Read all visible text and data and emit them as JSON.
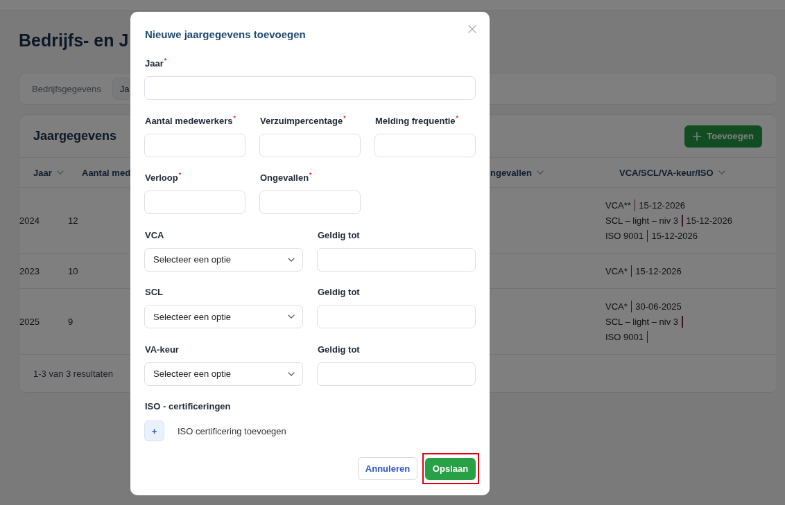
{
  "page": {
    "title": "Bedrijfs- en J",
    "tabs": [
      {
        "label": "Bedrijfsgegevens",
        "selected": false
      },
      {
        "label": "Ja",
        "selected": true
      }
    ]
  },
  "table": {
    "title": "Jaargegevens",
    "add_button": "Toevoegen",
    "columns": [
      {
        "label": "Jaar",
        "sortable": true
      },
      {
        "label": "Aantal med"
      },
      {
        "label": "ngevallen",
        "sortable": true
      },
      {
        "label": "VCA/SCL/VA-keur/ISO",
        "sortable": true
      }
    ],
    "rows": [
      {
        "cells": [
          "2024",
          "12"
        ],
        "certificates": [
          {
            "name": "VCA**",
            "valid_until": "15-12-2026"
          },
          {
            "name": "SCL – light – niv 3",
            "valid_until": "15-12-2026"
          },
          {
            "name": "ISO 9001",
            "valid_until": "15-12-2026"
          }
        ]
      },
      {
        "cells": [
          "2023",
          "10"
        ],
        "certificates": [
          {
            "name": "VCA*",
            "valid_until": "15-12-2026"
          }
        ]
      },
      {
        "cells": [
          "2025",
          "9"
        ],
        "certificates": [
          {
            "name": "VCA*",
            "valid_until": "30-06-2025"
          },
          {
            "name": "SCL – light – niv 3"
          },
          {
            "name": "ISO 9001"
          }
        ]
      }
    ],
    "footer": "1-3 van 3 resultaten"
  },
  "modal": {
    "title": "Nieuwe jaargegevens toevoegen",
    "year_field": {
      "label": "Jaar",
      "required_mark": "*"
    },
    "metric_fields": [
      {
        "label": "Aantal medewerkers",
        "required_mark": "*"
      },
      {
        "label": "Verzuimpercentage",
        "required_mark": "*"
      },
      {
        "label": "Melding frequentie",
        "required_mark": "*"
      },
      {
        "label": "Verloop",
        "required_mark": "*"
      },
      {
        "label": "Ongevallen",
        "required_mark": "*"
      }
    ],
    "certificate_fields": [
      {
        "label": "VCA",
        "placeholder": "Selecteer een optie",
        "date_label": "Geldig tot"
      },
      {
        "label": "SCL",
        "placeholder": "Selecteer een optie",
        "date_label": "Geldig tot"
      },
      {
        "label": "VA-keur",
        "placeholder": "Selecteer een optie",
        "date_label": "Geldig tot"
      }
    ],
    "iso": {
      "label": "ISO - certificeringen",
      "add_button": "+",
      "add_label": "ISO certificering toevoegen"
    },
    "actions": [
      {
        "label": "Annuleren",
        "kind": "secondary",
        "highlighted": false
      },
      {
        "label": "Opslaan",
        "kind": "primary",
        "highlighted": true
      }
    ]
  }
}
